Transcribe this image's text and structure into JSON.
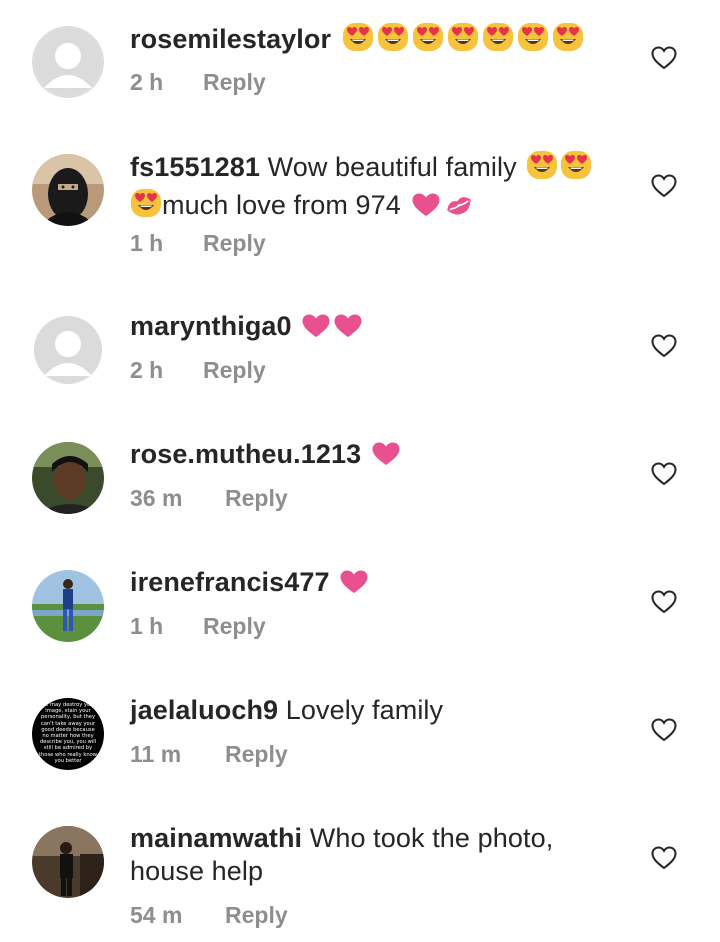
{
  "comments": [
    {
      "username": "rosemilestaylor",
      "text": "",
      "time": "2 h",
      "reply": "Reply",
      "emoji": [
        "heart-eyes",
        "heart-eyes",
        "heart-eyes",
        "heart-eyes",
        "heart-eyes",
        "heart-eyes",
        "heart-eyes"
      ]
    },
    {
      "username": "fs1551281",
      "text_line1": " Wow beautiful family ",
      "text_line2": "much love from 974 ",
      "time": "1 h",
      "reply": "Reply"
    },
    {
      "username": "marynthiga0",
      "text": "",
      "time": "2 h",
      "reply": "Reply"
    },
    {
      "username": "rose.mutheu.1213",
      "text": "",
      "time": "36 m",
      "reply": "Reply"
    },
    {
      "username": "irenefrancis477",
      "text": "",
      "time": "1 h",
      "reply": "Reply"
    },
    {
      "username": "jaelaluoch9",
      "text": " Lovely family",
      "time": "11 m",
      "reply": "Reply"
    },
    {
      "username": "mainamwathi",
      "text_line1": " Who took the photo,",
      "text_line2": "house help",
      "time": "54 m",
      "reply": "Reply"
    }
  ],
  "avatar_quote": "We may destroy your image, stain your personality, but they can't take away your good deeds because no matter how they describe you, you will still be admired by those who really know you better",
  "colors": {
    "text": "#262626",
    "meta": "#8e8e8e",
    "heart_emoji": "#e8508f",
    "emoji_face": "#f7c23c",
    "like_icon": "#262626"
  }
}
